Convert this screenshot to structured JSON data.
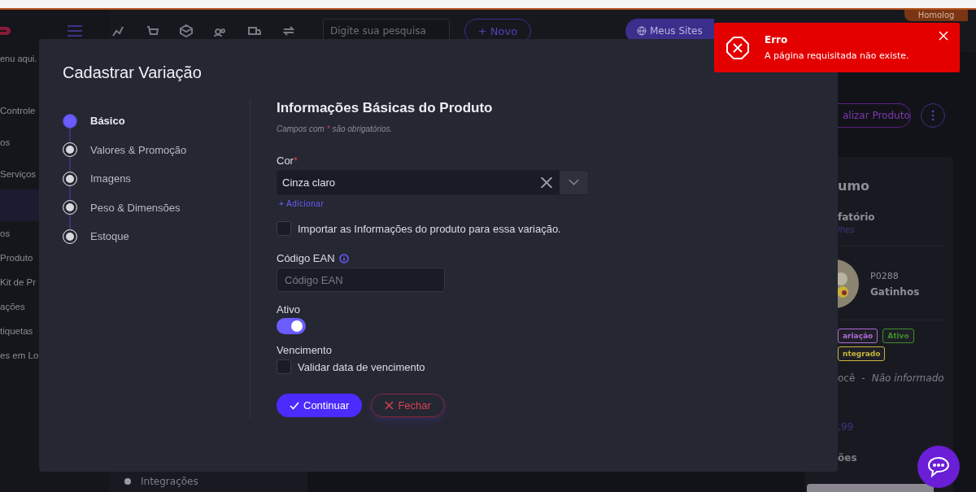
{
  "environment_tab": "Homolog",
  "sidebar": {
    "search_fragment": "enu aqui.",
    "items": [
      {
        "label": "Controle",
        "selected": false,
        "kind": "group"
      },
      {
        "label": "os",
        "selected": false,
        "kind": "group"
      },
      {
        "label": "Serviços",
        "selected": false,
        "kind": "group"
      },
      {
        "selected": true,
        "kind": "group"
      },
      {
        "label": "os",
        "selected": false,
        "kind": "item"
      },
      {
        "label": "Produto",
        "selected": false,
        "kind": "item"
      },
      {
        "label": "Kit de Pr",
        "selected": false,
        "kind": "item"
      },
      {
        "label": "ações",
        "selected": false,
        "kind": "item"
      },
      {
        "label": "tiquetas",
        "selected": false,
        "kind": "item"
      },
      {
        "label": "es em Lo",
        "selected": false,
        "kind": "item"
      }
    ]
  },
  "header": {
    "search": {
      "placeholder": "Digite sua pesquisa"
    },
    "new_button": "+ Novo",
    "sites_button": "Meus Sites"
  },
  "background_panel": {
    "item": "Integrações"
  },
  "summary": {
    "action_button": "alizar Produto",
    "title": "umo",
    "subtitle": "fatório",
    "link": "lhes",
    "product": {
      "code": "P0288",
      "name": "Gatinhos"
    },
    "tags": [
      {
        "label": "ariação",
        "color": "#b26ad8"
      },
      {
        "label": "Ativo",
        "color": "#3f8f2a"
      },
      {
        "label": "ntegrado",
        "color": "#c9b43a"
      }
    ],
    "owner": "ocê",
    "separator": "-",
    "owner_value": "Não informado",
    "price": ",99",
    "section": "ões"
  },
  "modal": {
    "title": "Cadastrar Variação",
    "steps": [
      {
        "label": "Básico",
        "selected": true
      },
      {
        "label": "Valores & Promoção",
        "selected": false
      },
      {
        "label": "Imagens",
        "selected": false
      },
      {
        "label": "Peso & Dimensões",
        "selected": false
      },
      {
        "label": "Estoque",
        "selected": false
      }
    ],
    "heading": "Informações Básicas do Produto",
    "required_note": {
      "before": "Campos com",
      "mark": "*",
      "after": "são obrigatórios."
    },
    "color_field": {
      "label": "Cor",
      "required_mark": "*",
      "value": "Cinza claro",
      "add_link": "+ Adicionar"
    },
    "import_option": {
      "label": "Importar as Informações do produto para essa variação.",
      "checked": false
    },
    "ean_field": {
      "label": "Código EAN",
      "placeholder": "Código EAN"
    },
    "active_field": {
      "label": "Ativo",
      "on": true
    },
    "expiry": {
      "label": "Vencimento",
      "option": "Validar data de vencimento",
      "checked": false
    },
    "buttons": [
      {
        "label": "Continuar",
        "kind": "primary"
      },
      {
        "label": "Fechar",
        "kind": "danger"
      }
    ]
  },
  "toast": {
    "title": "Erro",
    "message": "A página requisitada não existe."
  }
}
